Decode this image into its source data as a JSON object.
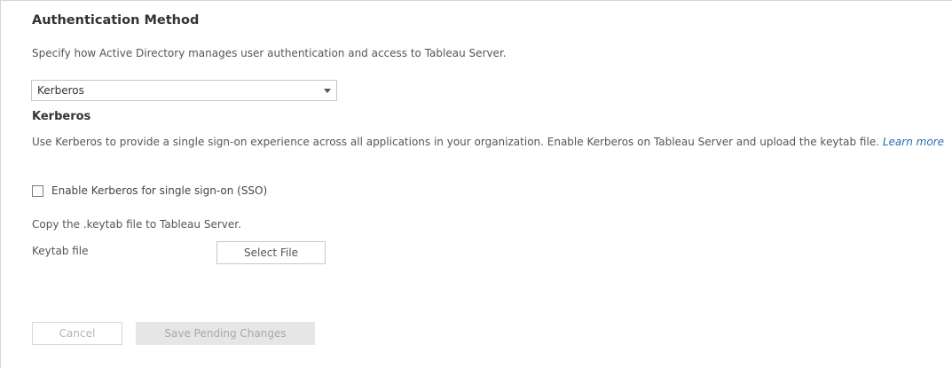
{
  "section": {
    "title": "Authentication Method",
    "description": "Specify how Active Directory manages user authentication and access to Tableau Server."
  },
  "auth_select": {
    "value": "Kerberos",
    "arrow_icon": "triangle-down"
  },
  "kerberos": {
    "title": "Kerberos",
    "description": "Use Kerberos to provide a single sign-on experience across all applications in your organization. Enable Kerberos on Tableau Server and upload the keytab file.",
    "learn_more": "Learn more",
    "sso_checkbox": {
      "label": "Enable Kerberos for single sign-on (SSO)",
      "checked": false
    },
    "copy_instruction": "Copy the .keytab file to Tableau Server.",
    "keytab_label": "Keytab file",
    "select_file_label": "Select File"
  },
  "actions": {
    "cancel_label": "Cancel",
    "save_label": "Save Pending Changes"
  },
  "colors": {
    "link": "#2b6bb5",
    "disabled_text": "#a8a8a8",
    "disabled_fill": "#e6e6e6"
  }
}
